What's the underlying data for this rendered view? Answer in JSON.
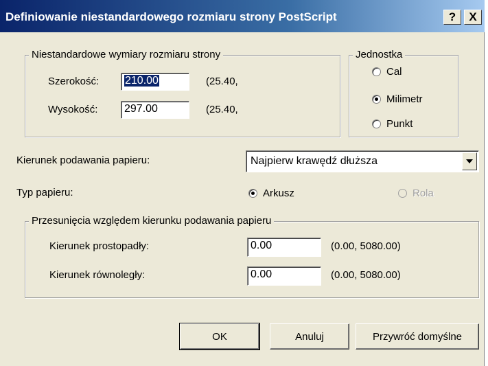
{
  "window": {
    "title": "Definiowanie niestandardowego rozmiaru strony PostScript",
    "help_label": "?",
    "close_label": "X"
  },
  "custom_size": {
    "legend": "Niestandardowe wymiary rozmiaru strony",
    "width_label": "Szerokość:",
    "width_value": "210.00",
    "width_range": "(25.40,",
    "height_label": "Wysokość:",
    "height_value": "297.00",
    "height_range": "(25.40,"
  },
  "unit": {
    "legend": "Jednostka",
    "options": [
      "Cal",
      "Milimetr",
      "Punkt"
    ],
    "selected": "Milimetr"
  },
  "feed": {
    "label": "Kierunek podawania papieru:",
    "selected": "Najpierw krawędź dłuższa"
  },
  "paper_type": {
    "label": "Typ papieru:",
    "options": [
      "Arkusz",
      "Rola"
    ],
    "selected": "Arkusz"
  },
  "offsets": {
    "legend": "Przesunięcia względem kierunku podawania papieru",
    "perpendicular_label": "Kierunek prostopadły:",
    "perpendicular_value": "0.00",
    "perpendicular_range": "(0.00, 5080.00)",
    "parallel_label": "Kierunek równoległy:",
    "parallel_value": "0.00",
    "parallel_range": "(0.00, 5080.00)"
  },
  "buttons": {
    "ok": "OK",
    "cancel": "Anuluj",
    "restore": "Przywróć domyślne"
  }
}
